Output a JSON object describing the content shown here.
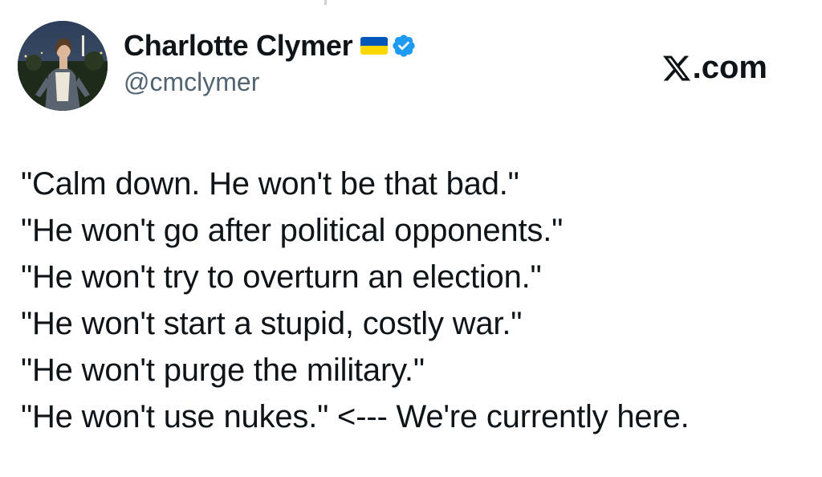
{
  "header": {
    "display_name": "Charlotte Clymer",
    "handle": "@cmclymer",
    "flag_icon": "ukraine-flag-icon",
    "verified_icon": "verified-badge-icon",
    "verified_color": "#1d9bf0",
    "flag_colors": [
      "#0057b7",
      "#ffd700"
    ]
  },
  "brand": {
    "logo_icon": "x-logo-icon",
    "suffix": ".com"
  },
  "tweet": {
    "lines": [
      "\"Calm down. He won't be that bad.\"",
      "\"He won't go after political opponents.\"",
      "\"He won't try to overturn an election.\"",
      "\"He won't start a stupid, costly war.\"",
      "\"He won't purge the military.\"",
      "\"He won't use nukes.\" <--- We're currently here."
    ]
  }
}
